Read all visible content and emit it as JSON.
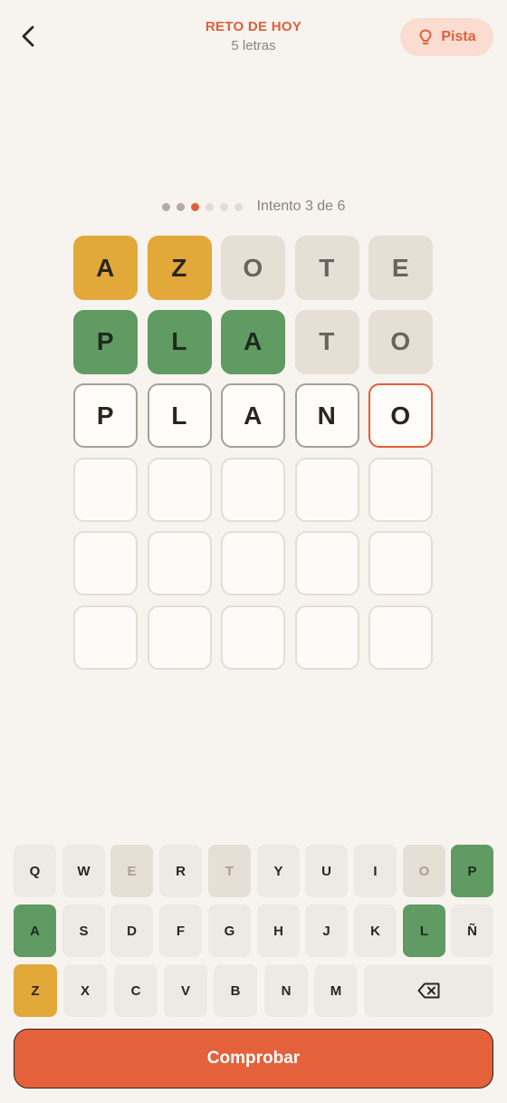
{
  "header": {
    "title": "RETO DE HOY",
    "subtitle": "5 letras",
    "hint_label": "Pista",
    "back_icon": "chevron-left-icon",
    "hint_icon": "lightbulb-icon"
  },
  "progress": {
    "total": 6,
    "current": 3,
    "label": "Intento 3 de 6"
  },
  "colors": {
    "accent": "#e05f3b",
    "correct": "#5f9b62",
    "present": "#e2a83a",
    "absent": "#e6dfd5",
    "background": "#f7f3ee"
  },
  "board": {
    "rows": [
      [
        {
          "letter": "A",
          "state": "present"
        },
        {
          "letter": "Z",
          "state": "present"
        },
        {
          "letter": "O",
          "state": "absent"
        },
        {
          "letter": "T",
          "state": "absent"
        },
        {
          "letter": "E",
          "state": "absent"
        }
      ],
      [
        {
          "letter": "P",
          "state": "correct"
        },
        {
          "letter": "L",
          "state": "correct"
        },
        {
          "letter": "A",
          "state": "correct"
        },
        {
          "letter": "T",
          "state": "absent"
        },
        {
          "letter": "O",
          "state": "absent"
        }
      ],
      [
        {
          "letter": "P",
          "state": "typed"
        },
        {
          "letter": "L",
          "state": "typed"
        },
        {
          "letter": "A",
          "state": "typed"
        },
        {
          "letter": "N",
          "state": "typed"
        },
        {
          "letter": "O",
          "state": "active"
        }
      ],
      [
        {
          "letter": "",
          "state": "empty"
        },
        {
          "letter": "",
          "state": "empty"
        },
        {
          "letter": "",
          "state": "empty"
        },
        {
          "letter": "",
          "state": "empty"
        },
        {
          "letter": "",
          "state": "empty"
        }
      ],
      [
        {
          "letter": "",
          "state": "empty"
        },
        {
          "letter": "",
          "state": "empty"
        },
        {
          "letter": "",
          "state": "empty"
        },
        {
          "letter": "",
          "state": "empty"
        },
        {
          "letter": "",
          "state": "empty"
        }
      ],
      [
        {
          "letter": "",
          "state": "empty"
        },
        {
          "letter": "",
          "state": "empty"
        },
        {
          "letter": "",
          "state": "empty"
        },
        {
          "letter": "",
          "state": "empty"
        },
        {
          "letter": "",
          "state": "empty"
        }
      ]
    ]
  },
  "keyboard": {
    "rows": [
      [
        {
          "label": "Q",
          "state": "default"
        },
        {
          "label": "W",
          "state": "default"
        },
        {
          "label": "E",
          "state": "absent"
        },
        {
          "label": "R",
          "state": "default"
        },
        {
          "label": "T",
          "state": "absent"
        },
        {
          "label": "Y",
          "state": "default"
        },
        {
          "label": "U",
          "state": "default"
        },
        {
          "label": "I",
          "state": "default"
        },
        {
          "label": "O",
          "state": "absent"
        },
        {
          "label": "P",
          "state": "correct"
        }
      ],
      [
        {
          "label": "A",
          "state": "correct"
        },
        {
          "label": "S",
          "state": "default"
        },
        {
          "label": "D",
          "state": "default"
        },
        {
          "label": "F",
          "state": "default"
        },
        {
          "label": "G",
          "state": "default"
        },
        {
          "label": "H",
          "state": "default"
        },
        {
          "label": "J",
          "state": "default"
        },
        {
          "label": "K",
          "state": "default"
        },
        {
          "label": "L",
          "state": "correct"
        },
        {
          "label": "Ñ",
          "state": "default"
        }
      ],
      [
        {
          "label": "Z",
          "state": "present"
        },
        {
          "label": "X",
          "state": "default"
        },
        {
          "label": "C",
          "state": "default"
        },
        {
          "label": "V",
          "state": "default"
        },
        {
          "label": "B",
          "state": "default"
        },
        {
          "label": "N",
          "state": "default"
        },
        {
          "label": "M",
          "state": "default"
        }
      ]
    ],
    "backspace_icon": "backspace-icon"
  },
  "submit_label": "Comprobar"
}
